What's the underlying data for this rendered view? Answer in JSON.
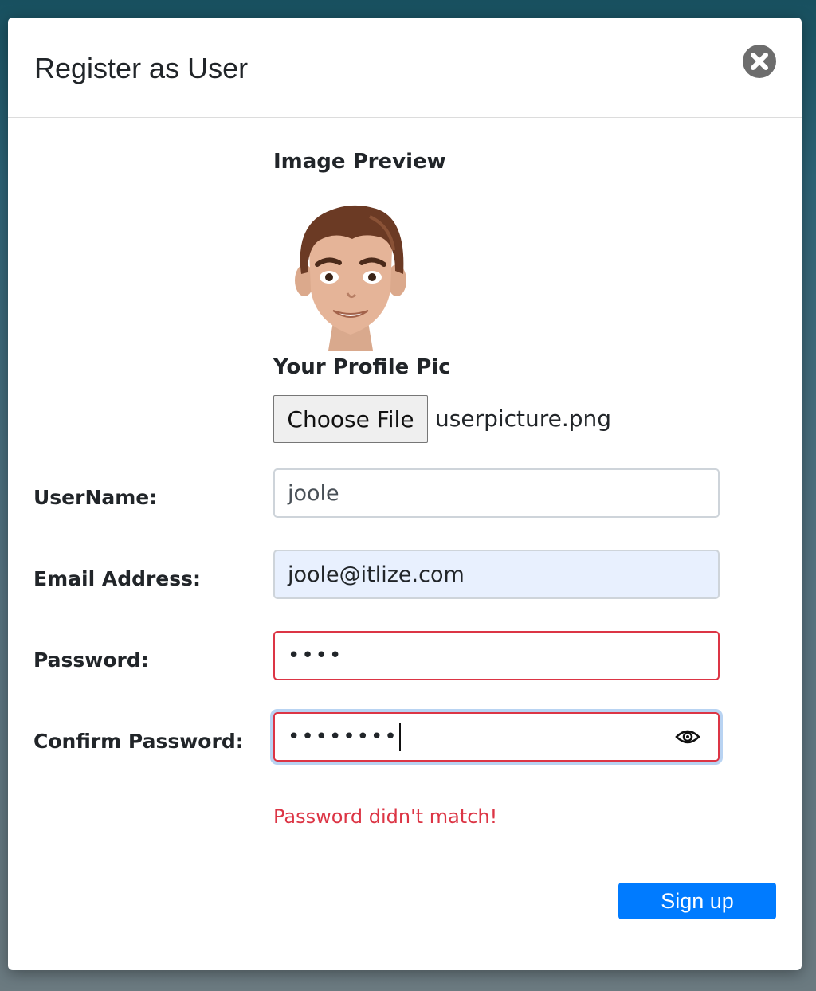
{
  "modal": {
    "title": "Register as User"
  },
  "preview": {
    "title": "Image Preview",
    "profile_label": "Your Profile Pic"
  },
  "file_input": {
    "button_label": "Choose File",
    "file_name": "userpicture.png"
  },
  "form": {
    "username": {
      "label": "UserName:",
      "value": "joole"
    },
    "email": {
      "label": "Email Address:",
      "value": "joole@itlize.com"
    },
    "password": {
      "label": "Password:",
      "masked": "••••"
    },
    "confirm_password": {
      "label": "Confirm Password:",
      "masked": "••••••••"
    }
  },
  "error": {
    "message": "Password didn't match!"
  },
  "footer": {
    "signup_label": "Sign up"
  },
  "colors": {
    "primary": "#007bff",
    "error": "#dc3545",
    "autofill": "#e8f0fe",
    "close_bg": "#6d6d6d"
  },
  "icons": {
    "close": "close-circle-icon",
    "eye": "eye-icon"
  }
}
